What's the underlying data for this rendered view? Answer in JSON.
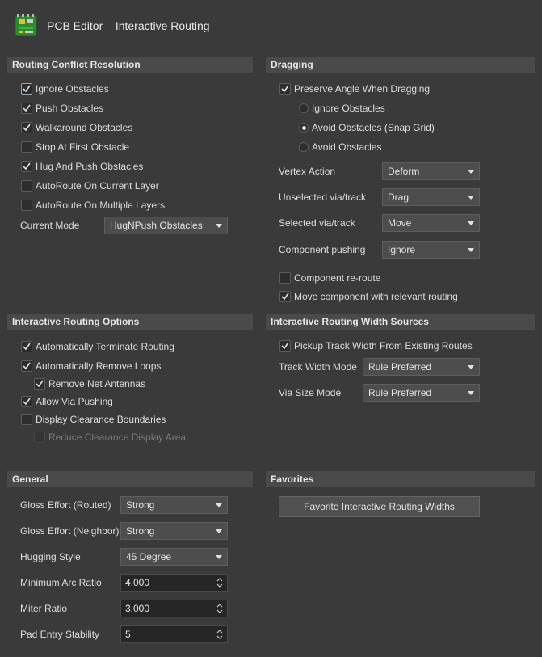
{
  "window": {
    "title": "PCB Editor – Interactive Routing",
    "icon": "pcb-board-icon"
  },
  "routing_conflict": {
    "header": "Routing Conflict Resolution",
    "options": [
      {
        "label": "Ignore Obstacles",
        "checked": true
      },
      {
        "label": "Push Obstacles",
        "checked": true
      },
      {
        "label": "Walkaround Obstacles",
        "checked": true
      },
      {
        "label": "Stop At First Obstacle",
        "checked": false
      },
      {
        "label": "Hug And Push Obstacles",
        "checked": true
      },
      {
        "label": "AutoRoute On Current Layer",
        "checked": false
      },
      {
        "label": "AutoRoute On Multiple Layers",
        "checked": false
      }
    ],
    "current_mode_label": "Current Mode",
    "current_mode_value": "HugNPush Obstacles"
  },
  "dragging": {
    "header": "Dragging",
    "preserve_angle_label": "Preserve Angle When Dragging",
    "radios": [
      {
        "label": "Ignore Obstacles",
        "selected": false
      },
      {
        "label": "Avoid Obstacles (Snap Grid)",
        "selected": true
      },
      {
        "label": "Avoid Obstacles",
        "selected": false
      }
    ],
    "vertex_action_label": "Vertex Action",
    "vertex_action_value": "Deform",
    "unselected_via_label": "Unselected via/track",
    "unselected_via_value": "Drag",
    "selected_via_label": "Selected via/track",
    "selected_via_value": "Move",
    "component_pushing_label": "Component pushing",
    "component_pushing_value": "Ignore",
    "component_reroute_label": "Component re-route",
    "move_component_label": "Move component with relevant routing"
  },
  "interactive_options": {
    "header": "Interactive Routing Options",
    "auto_terminate_label": "Automatically Terminate Routing",
    "auto_remove_loops_label": "Automatically Remove Loops",
    "remove_net_antennas_label": "Remove Net Antennas",
    "allow_via_pushing_label": "Allow Via Pushing",
    "display_clearance_label": "Display Clearance Boundaries",
    "reduce_clearance_label": "Reduce Clearance Display Area"
  },
  "width_sources": {
    "header": "Interactive Routing Width Sources",
    "pickup_label": "Pickup Track Width From Existing Routes",
    "track_width_mode_label": "Track Width Mode",
    "track_width_mode_value": "Rule Preferred",
    "via_size_mode_label": "Via Size Mode",
    "via_size_mode_value": "Rule Preferred"
  },
  "general": {
    "header": "General",
    "gloss_routed_label": "Gloss Effort (Routed)",
    "gloss_routed_value": "Strong",
    "gloss_neighbor_label": "Gloss Effort (Neighbor)",
    "gloss_neighbor_value": "Strong",
    "hugging_style_label": "Hugging Style",
    "hugging_style_value": "45 Degree",
    "min_arc_ratio_label": "Minimum Arc Ratio",
    "min_arc_ratio_value": "4.000",
    "miter_ratio_label": "Miter Ratio",
    "miter_ratio_value": "3.000",
    "pad_entry_label": "Pad Entry Stability",
    "pad_entry_value": "5"
  },
  "favorites": {
    "header": "Favorites",
    "button_label": "Favorite Interactive Routing Widths"
  },
  "colors": {
    "background": "#3a3a3a",
    "section_header": "#4a4a4a",
    "text": "#d8d8d8"
  }
}
